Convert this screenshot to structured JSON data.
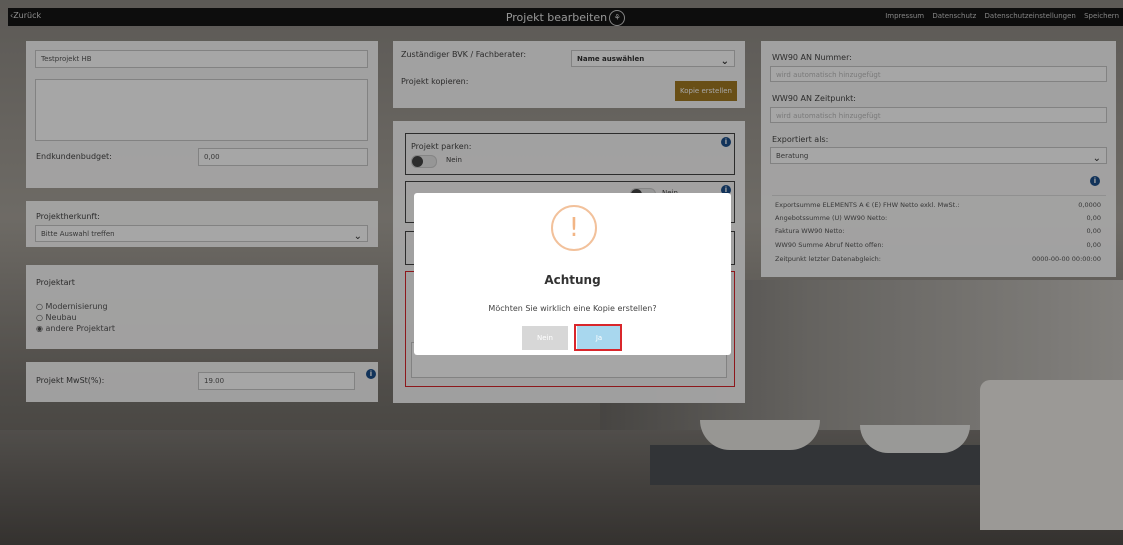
{
  "topbar": {
    "back": "Zurück",
    "title": "Projekt bearbeiten",
    "links": [
      "Impressum",
      "Datenschutz",
      "Datenschutzeinstellungen",
      "Speichern"
    ]
  },
  "left": {
    "project_name": "Testprojekt HB",
    "budget_label": "Endkundenbudget:",
    "budget_value": "0,00",
    "origin_label": "Projektherkunft:",
    "origin_value": "Bitte Auswahl treffen",
    "type_label": "Projektart",
    "type_options": [
      "Modernisierung",
      "Neubau",
      "andere Projektart"
    ],
    "type_selected": 2,
    "vat_label": "Projekt MwSt(%):",
    "vat_value": "19.00"
  },
  "middle": {
    "advisor_label": "Zuständiger BVK / Fachberater:",
    "advisor_value": "Name auswählen",
    "copy_label": "Projekt kopieren:",
    "copy_button": "Kopie erstellen",
    "park_label": "Projekt parken:",
    "park_value": "Nein",
    "closed_value": "Nein"
  },
  "right": {
    "an_number_label": "WW90 AN Nummer:",
    "an_number_placeholder": "wird automatisch hinzugefügt",
    "an_time_label": "WW90 AN Zeitpunkt:",
    "an_time_placeholder": "wird automatisch hinzugefügt",
    "exported_label": "Exportiert als:",
    "exported_value": "Beratung",
    "stats": [
      {
        "label": "Exportsumme ELEMENTS A € (E) FHW Netto exkl. MwSt.:",
        "value": "0,0000"
      },
      {
        "label": "Angebotssumme (U) WW90 Netto:",
        "value": "0,00"
      },
      {
        "label": "Faktura WW90 Netto:",
        "value": "0,00"
      },
      {
        "label": "WW90 Summe Abruf Netto offen:",
        "value": "0,00"
      },
      {
        "label": "Zeitpunkt letzter Datenabgleich:",
        "value": "0000-00-00 00:00:00"
      }
    ]
  },
  "modal": {
    "icon": "!",
    "title": "Achtung",
    "text": "Möchten Sie wirklich eine Kopie erstellen?",
    "no": "Nein",
    "yes": "Ja"
  },
  "colors": {
    "gold_button": "#a27a22",
    "info_icon": "#1c4f8b",
    "highlight_red": "#d9262b",
    "yes_button": "#a8d7ee"
  }
}
